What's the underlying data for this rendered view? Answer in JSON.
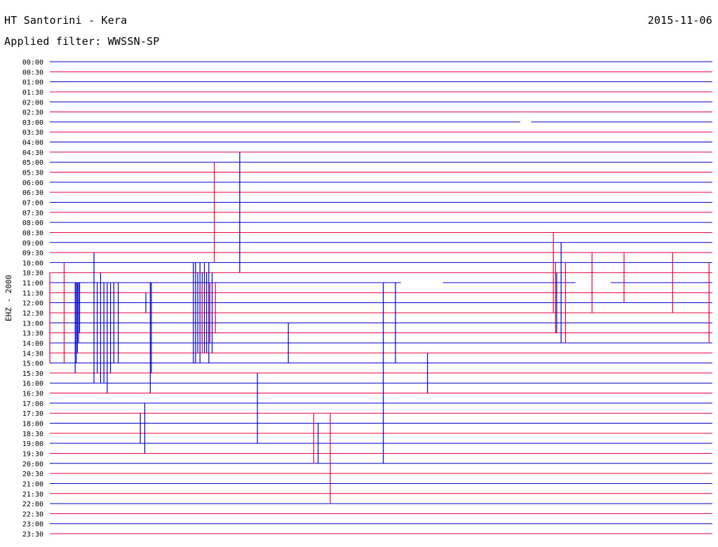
{
  "header": {
    "title": "HT Santorini - Kera",
    "date": "2015-11-06",
    "filter": "Applied filter: WWSSN-SP"
  },
  "chart_data": {
    "type": "helicorder",
    "channel_label": "EHZ - 2000",
    "row_labels": [
      "00:00",
      "00:30",
      "01:00",
      "01:30",
      "02:00",
      "02:30",
      "03:00",
      "03:30",
      "04:00",
      "04:30",
      "05:00",
      "05:30",
      "06:00",
      "06:30",
      "07:00",
      "07:30",
      "08:00",
      "08:30",
      "09:00",
      "09:30",
      "10:00",
      "10:30",
      "11:00",
      "11:30",
      "12:00",
      "12:30",
      "13:00",
      "13:30",
      "14:00",
      "14:30",
      "15:00",
      "15:30",
      "16:00",
      "16:30",
      "17:00",
      "17:30",
      "18:00",
      "18:30",
      "19:00",
      "19:30",
      "20:00",
      "20:30",
      "21:00",
      "21:30",
      "22:00",
      "22:30",
      "23:00",
      "23:30"
    ],
    "row_minutes": 30,
    "line_colors": [
      "#0000cc",
      "#e8003c"
    ],
    "trace_gaps": [
      {
        "row": 6,
        "from_min": 21.3,
        "to_min": 21.8
      },
      {
        "row": 22,
        "from_min": 15.9,
        "to_min": 17.8
      },
      {
        "row": 22,
        "from_min": 23.8,
        "to_min": 25.4
      }
    ],
    "events": [
      {
        "row": 21,
        "min": 0.0,
        "up": 0,
        "down": 9
      },
      {
        "row": 21,
        "min": 0.65,
        "up": 1,
        "down": 9
      },
      {
        "row": 22,
        "min": 1.15,
        "up": 0,
        "down": 9
      },
      {
        "row": 22,
        "min": 1.2,
        "up": 0,
        "down": 8
      },
      {
        "row": 22,
        "min": 1.25,
        "up": 0,
        "down": 7
      },
      {
        "row": 22,
        "min": 1.3,
        "up": 0,
        "down": 6
      },
      {
        "row": 22,
        "min": 1.35,
        "up": 0,
        "down": 5
      },
      {
        "row": 22,
        "min": 2.0,
        "up": 3,
        "down": 10
      },
      {
        "row": 22,
        "min": 2.15,
        "up": 0,
        "down": 9
      },
      {
        "row": 22,
        "min": 2.3,
        "up": 1,
        "down": 10
      },
      {
        "row": 22,
        "min": 2.45,
        "up": 0,
        "down": 10
      },
      {
        "row": 22,
        "min": 2.6,
        "up": 0,
        "down": 11
      },
      {
        "row": 22,
        "min": 2.75,
        "up": 0,
        "down": 9
      },
      {
        "row": 22,
        "min": 2.9,
        "up": 0,
        "down": 8
      },
      {
        "row": 22,
        "min": 3.1,
        "up": 0,
        "down": 8
      },
      {
        "row": 22,
        "min": 4.55,
        "up": 0,
        "down": 11
      },
      {
        "row": 22,
        "min": 4.6,
        "up": 0,
        "down": 9
      },
      {
        "row": 24,
        "min": 4.35,
        "up": 1,
        "down": 1
      },
      {
        "row": 36,
        "min": 4.1,
        "up": 1,
        "down": 2
      },
      {
        "row": 36,
        "min": 4.3,
        "up": 2,
        "down": 3
      },
      {
        "row": 24,
        "min": 6.5,
        "up": 4,
        "down": 6
      },
      {
        "row": 24,
        "min": 6.6,
        "up": 4,
        "down": 6
      },
      {
        "row": 24,
        "min": 6.7,
        "up": 3,
        "down": 5
      },
      {
        "row": 24,
        "min": 6.8,
        "up": 4,
        "down": 6
      },
      {
        "row": 24,
        "min": 6.9,
        "up": 3,
        "down": 4
      },
      {
        "row": 24,
        "min": 7.0,
        "up": 4,
        "down": 5
      },
      {
        "row": 24,
        "min": 7.1,
        "up": 3,
        "down": 5
      },
      {
        "row": 24,
        "min": 7.2,
        "up": 4,
        "down": 6
      },
      {
        "row": 24,
        "min": 7.35,
        "up": 3,
        "down": 5
      },
      {
        "row": 23,
        "min": 6.9,
        "up": 1,
        "down": 6
      },
      {
        "row": 23,
        "min": 7.25,
        "up": 1,
        "down": 5
      },
      {
        "row": 23,
        "min": 7.5,
        "up": 1,
        "down": 4
      },
      {
        "row": 11,
        "min": 7.45,
        "up": 1,
        "down": 9
      },
      {
        "row": 10,
        "min": 8.6,
        "up": 1,
        "down": 11
      },
      {
        "row": 28,
        "min": 10.8,
        "up": 2,
        "down": 2
      },
      {
        "row": 32,
        "min": 9.4,
        "up": 1,
        "down": 6
      },
      {
        "row": 35,
        "min": 11.95,
        "up": 0,
        "down": 5
      },
      {
        "row": 36,
        "min": 12.15,
        "up": 0,
        "down": 4
      },
      {
        "row": 37,
        "min": 12.7,
        "up": 2,
        "down": 7
      },
      {
        "row": 22,
        "min": 15.1,
        "up": 0,
        "down": 18
      },
      {
        "row": 22,
        "min": 15.65,
        "up": 0,
        "down": 8
      },
      {
        "row": 30,
        "min": 17.1,
        "up": 1,
        "down": 3
      },
      {
        "row": 19,
        "min": 22.8,
        "up": 2,
        "down": 6
      },
      {
        "row": 20,
        "min": 23.15,
        "up": 2,
        "down": 8
      },
      {
        "row": 21,
        "min": 23.35,
        "up": 1,
        "down": 7
      },
      {
        "row": 21,
        "min": 22.9,
        "up": 1,
        "down": 6
      },
      {
        "row": 22,
        "min": 22.95,
        "up": 1,
        "down": 5
      },
      {
        "row": 21,
        "min": 24.55,
        "up": 2,
        "down": 4
      },
      {
        "row": 21,
        "min": 26.0,
        "up": 2,
        "down": 3
      },
      {
        "row": 21,
        "min": 28.2,
        "up": 2,
        "down": 4
      },
      {
        "row": 21,
        "min": 29.85,
        "up": 1,
        "down": 7
      }
    ]
  }
}
